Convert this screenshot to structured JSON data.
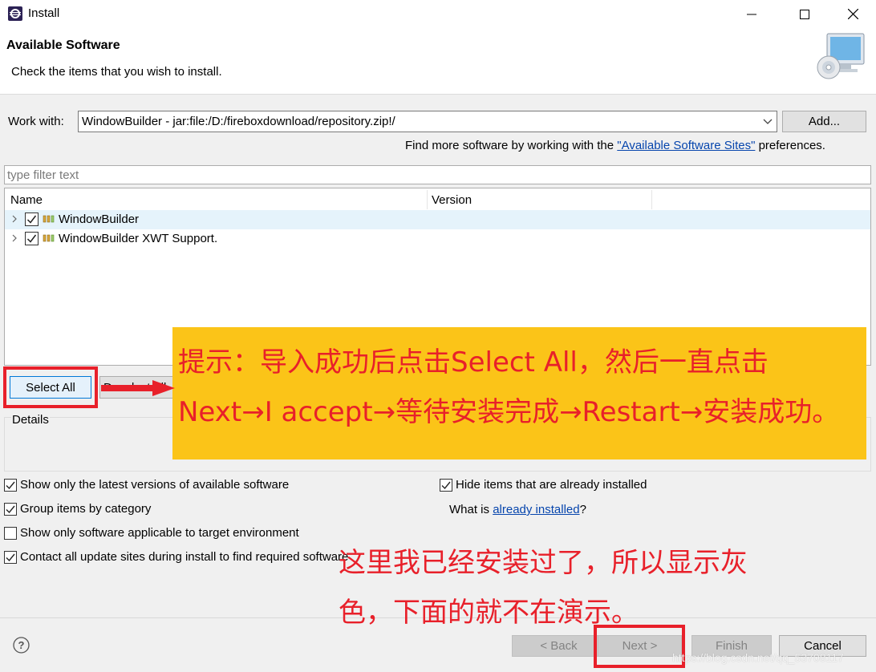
{
  "window": {
    "title": "Install",
    "icon": "eclipse-icon"
  },
  "header": {
    "title": "Available Software",
    "subtitle": "Check the items that you wish to install."
  },
  "work_with": {
    "label": "Work with:",
    "value": "WindowBuilder - jar:file:/D:/fireboxdownload/repository.zip!/",
    "add_label": "Add...",
    "find_more_prefix": "Find more software by working with the ",
    "find_more_link": "\"Available Software Sites\"",
    "find_more_suffix": " preferences."
  },
  "filter": {
    "placeholder": "type filter text"
  },
  "tree": {
    "columns": [
      "Name",
      "Version"
    ],
    "rows": [
      {
        "label": "WindowBuilder",
        "checked": true
      },
      {
        "label": "WindowBuilder XWT Support.",
        "checked": true
      }
    ]
  },
  "buttons": {
    "select_all": "Select All",
    "deselect_all": "Deselect All"
  },
  "details": {
    "label": "Details"
  },
  "options": {
    "latest_versions": "Show only the latest versions of available software",
    "group_by_category": "Group items by category",
    "applicable_only": "Show only software applicable to target environment",
    "contact_sites": "Contact all update sites during install to find required software",
    "hide_installed": "Hide items that are already installed",
    "what_is_prefix": "What is ",
    "what_is_link": "already installed",
    "what_is_suffix": "?"
  },
  "footer": {
    "back": "< Back",
    "next": "Next >",
    "finish": "Finish",
    "cancel": "Cancel"
  },
  "annotation": {
    "line1": "提示：导入成功后点击Select All，然后一直点击",
    "line2": "Next→I accept→等待安装完成→Restart→安装成功。",
    "note2_line1": "这里我已经安装过了，所以显示灰",
    "note2_line2": "色，下面的就不在演示。",
    "watermark": "https://blog.csdn.net/qq_53708117",
    "note_color": "#e8202a",
    "box_color": "#fbc418"
  }
}
